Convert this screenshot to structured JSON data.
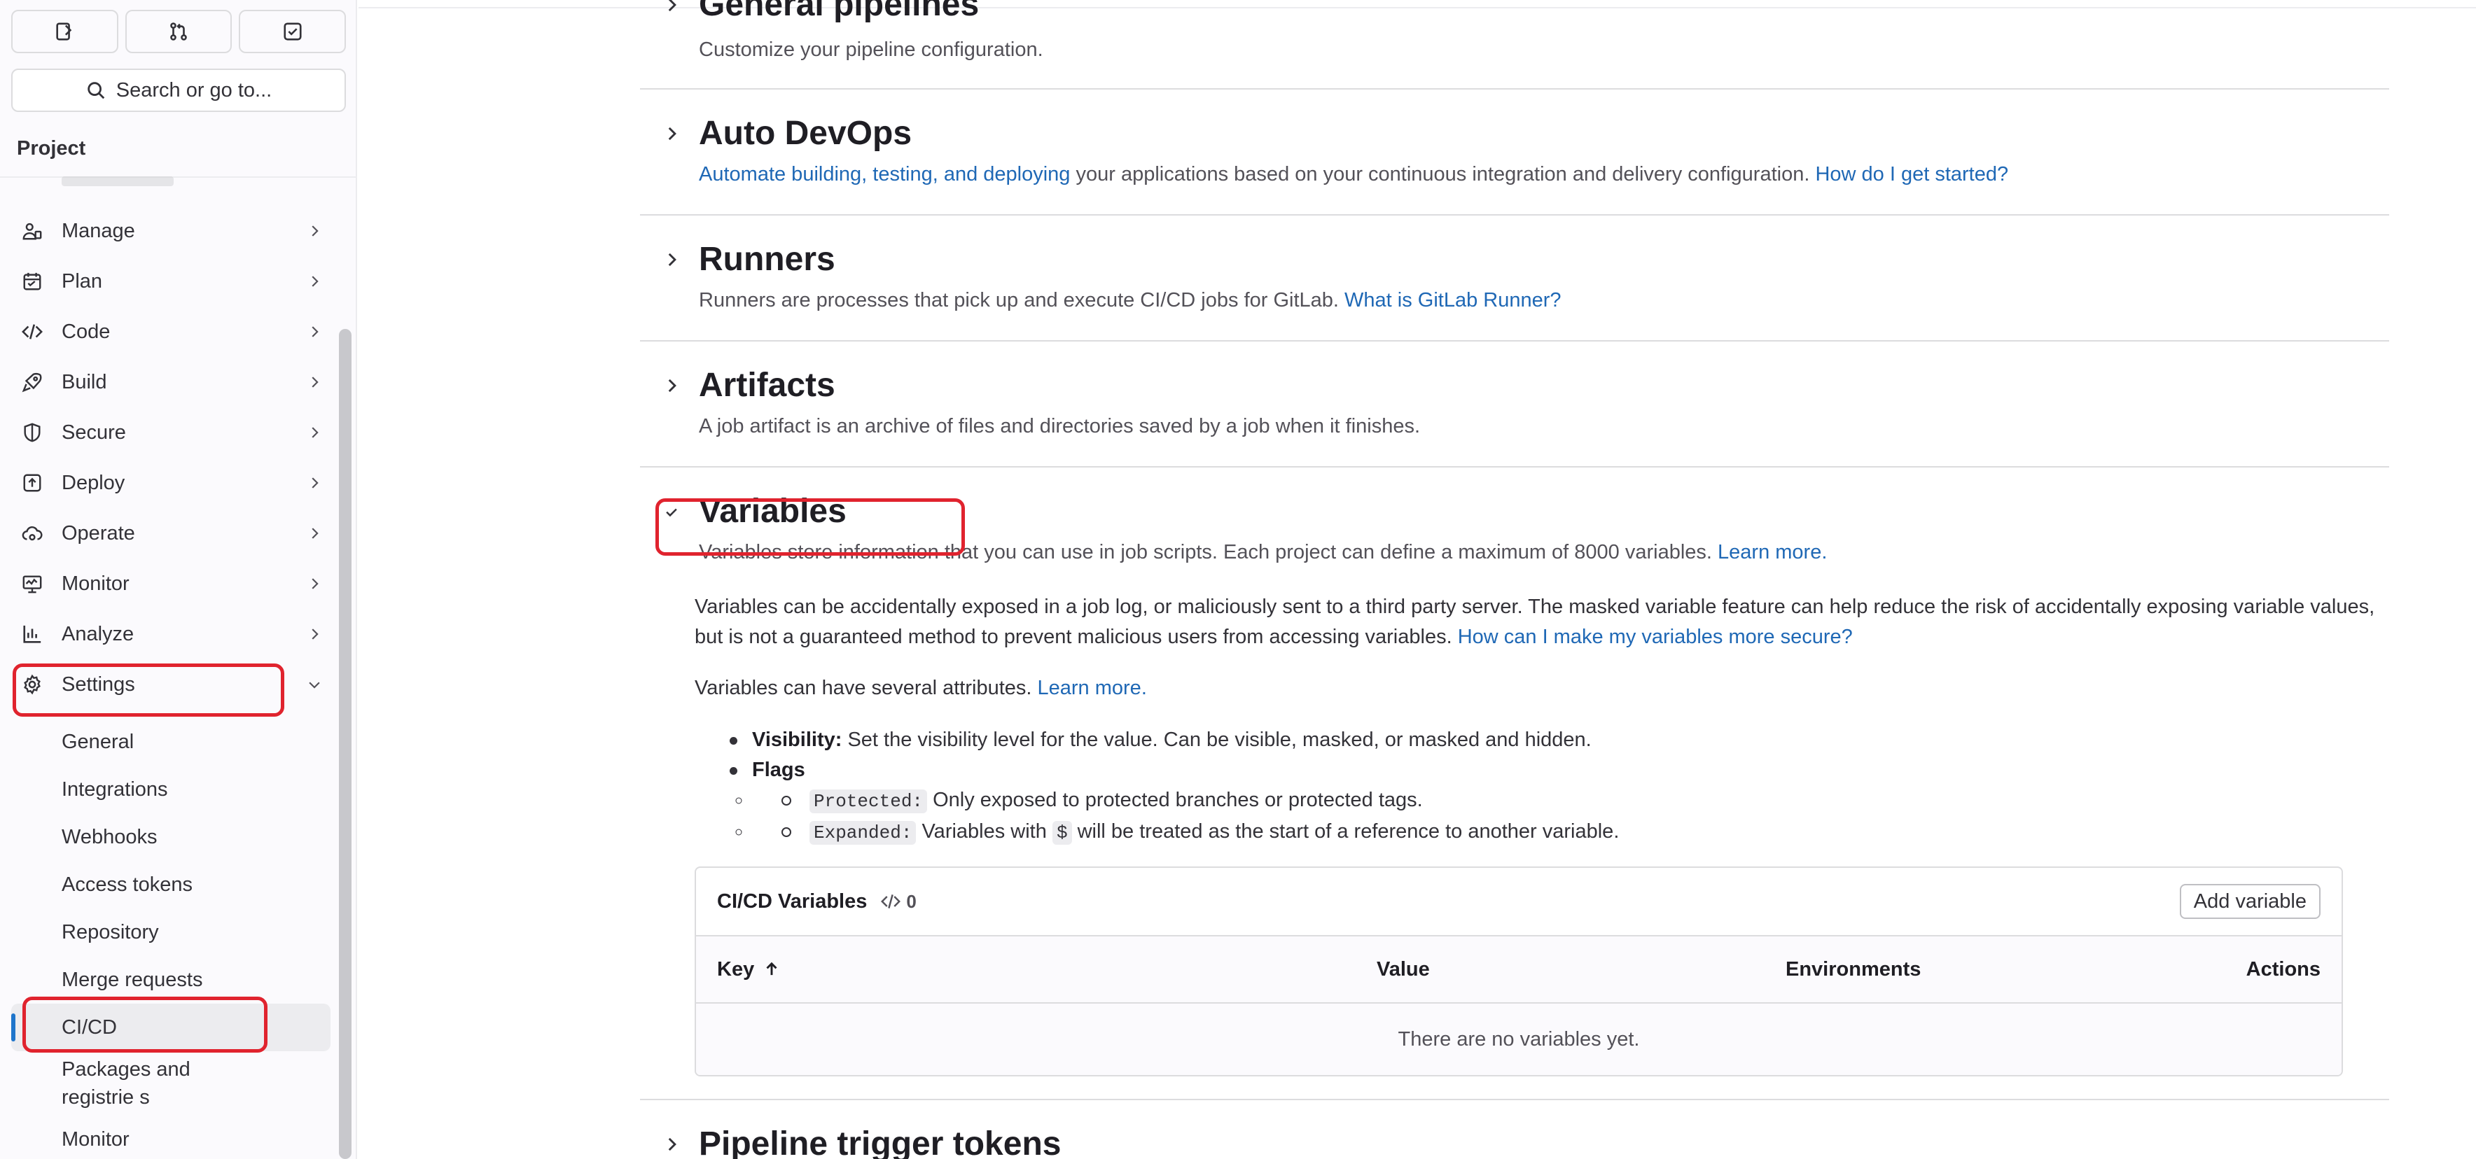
{
  "sidebar": {
    "search_placeholder": "Search or go to...",
    "heading": "Project",
    "items": [
      {
        "label": "Manage",
        "icon": "users-icon"
      },
      {
        "label": "Plan",
        "icon": "calendar-icon"
      },
      {
        "label": "Code",
        "icon": "code-icon"
      },
      {
        "label": "Build",
        "icon": "rocket-icon"
      },
      {
        "label": "Secure",
        "icon": "shield-icon"
      },
      {
        "label": "Deploy",
        "icon": "deploy-icon"
      },
      {
        "label": "Operate",
        "icon": "cloud-gear-icon"
      },
      {
        "label": "Monitor",
        "icon": "monitor-icon"
      },
      {
        "label": "Analyze",
        "icon": "chart-icon"
      }
    ],
    "settings_label": "Settings",
    "sub_items": [
      "General",
      "Integrations",
      "Webhooks",
      "Access tokens",
      "Repository",
      "Merge requests",
      "CI/CD",
      "Packages and registrie s",
      "Monitor"
    ]
  },
  "sections": {
    "general": {
      "title": "General pipelines",
      "desc": "Customize your pipeline configuration."
    },
    "autodevops": {
      "title": "Auto DevOps",
      "link": "Automate building, testing, and deploying",
      "desc": " your applications based on your continuous integration and delivery configuration. ",
      "link2": "How do I get started?"
    },
    "runners": {
      "title": "Runners",
      "desc": "Runners are processes that pick up and execute CI/CD jobs for GitLab. ",
      "link": "What is GitLab Runner?"
    },
    "artifacts": {
      "title": "Artifacts",
      "desc": "A job artifact is an archive of files and directories saved by a job when it finishes."
    },
    "variables": {
      "title": "Variables",
      "desc": "Variables store information that you can use in job scripts. Each project can define a maximum of 8000 variables. ",
      "desc_link": "Learn more.",
      "para1": "Variables can be accidentally exposed in a job log, or maliciously sent to a third party server. The masked variable feature can help reduce the risk of accidentally exposing variable values, but is not a guaranteed method to prevent malicious users from accessing variables. ",
      "para1_link": "How can I make my variables more secure?",
      "para2": "Variables can have several attributes. ",
      "para2_link": "Learn more.",
      "visibility_label": "Visibility:",
      "visibility_text": " Set the visibility level for the value. Can be visible, masked, or masked and hidden.",
      "flags_label": "Flags",
      "protected_code": "Protected:",
      "protected_text": " Only exposed to protected branches or protected tags.",
      "expanded_code": "Expanded:",
      "expanded_text_a": " Variables with ",
      "expanded_dollar": "$",
      "expanded_text_b": " will be treated as the start of a reference to another variable."
    },
    "triggers": {
      "title": "Pipeline trigger tokens"
    }
  },
  "variables_table": {
    "title": "CI/CD Variables",
    "count": "0",
    "add_button": "Add variable",
    "columns": [
      "Key",
      "Value",
      "Environments",
      "Actions"
    ],
    "empty_text": "There are no variables yet."
  },
  "colors": {
    "link": "#1f68b5",
    "highlight": "#e0232e",
    "active_bar": "#1f75cb"
  }
}
